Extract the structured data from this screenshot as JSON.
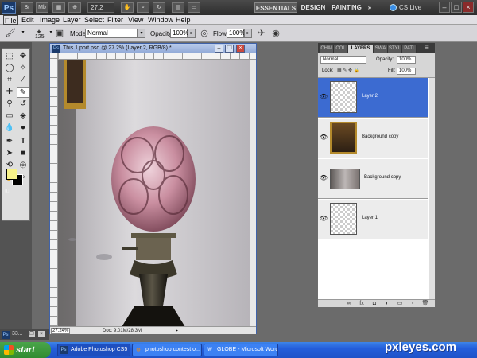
{
  "appbar": {
    "logo": "Ps",
    "zoom": "27.2",
    "workspaces": [
      "ESSENTIALS",
      "DESIGN",
      "PAINTING"
    ],
    "more": "»",
    "cslive": "CS Live",
    "controls": [
      "–",
      "□",
      "×"
    ]
  },
  "menu": [
    "File",
    "Edit",
    "Image",
    "Layer",
    "Select",
    "Filter",
    "View",
    "Window",
    "Help"
  ],
  "options": {
    "brush_size": "125",
    "mode_label": "Mode:",
    "mode_value": "Normal",
    "opacity_label": "Opacity:",
    "opacity_value": "100%",
    "flow_label": "Flow:",
    "flow_value": "100%"
  },
  "document": {
    "title": "This 1 port.psd @ 27.2% (Layer 2, RGB/8) *",
    "zoom": "27.24%",
    "doc_size": "Doc: 9.01M/28.3M"
  },
  "layers_panel": {
    "tabs": [
      "CHAI",
      "COL",
      "LAYERS",
      "SWA",
      "STYL",
      "PATI"
    ],
    "blend_mode": "Normal",
    "opacity_label": "Opacity:",
    "opacity_value": "100%",
    "lock_label": "Lock:",
    "fill_label": "Fill:",
    "fill_value": "100%",
    "layers": [
      {
        "name": "Layer 2",
        "selected": true
      },
      {
        "name": "Background copy",
        "selected": false
      },
      {
        "name": "Background copy",
        "selected": false
      },
      {
        "name": "Layer 1",
        "selected": false
      }
    ],
    "footer_icons": [
      "link-icon",
      "fx-icon",
      "mask-icon",
      "adjustment-icon",
      "folder-icon",
      "new-layer-icon",
      "trash-icon"
    ]
  },
  "swatches": {
    "foreground": "#f7f28a",
    "background": "#000000"
  },
  "taskbar": {
    "start": "start",
    "tasks": [
      "Adobe Photoshop CS5",
      "photoshop contest o...",
      "GLOBE - Microsoft Word"
    ],
    "tray_ps": "33..."
  },
  "watermark": "pxleyes.com"
}
